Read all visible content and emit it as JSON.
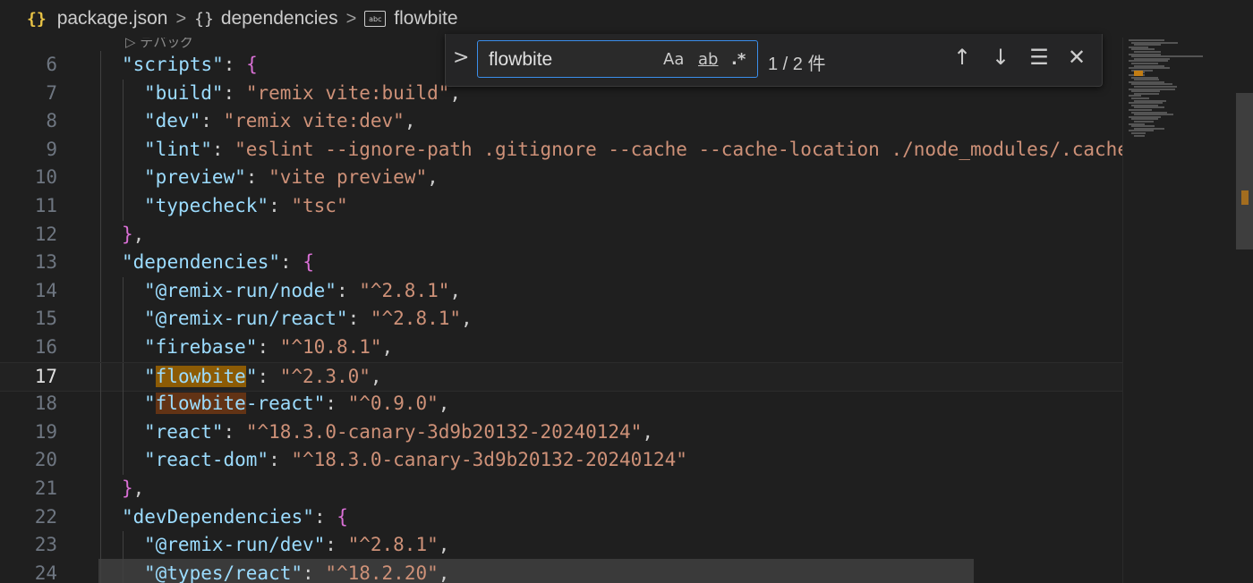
{
  "breadcrumb": {
    "file_icon": "{}",
    "file": "package.json",
    "obj_icon": "{}",
    "section": "dependencies",
    "string_icon": "abc",
    "item": "flowbite",
    "separator": ">"
  },
  "codelens": {
    "icon": "▷",
    "label": "デバッグ"
  },
  "find": {
    "toggle": ">",
    "query": "flowbite",
    "match_case": "Aa",
    "whole_word": "ab",
    "regex": ".*",
    "count": "1 / 2 件",
    "prev": "↑",
    "next": "↓",
    "find_in_selection": "☰",
    "close": "✕"
  },
  "lines": [
    {
      "n": "6",
      "indent": 1,
      "key": "\"scripts\"",
      "mid": ": ",
      "open": "{"
    },
    {
      "n": "7",
      "indent": 2,
      "key": "\"build\"",
      "mid": ": ",
      "value": "\"remix vite:build\"",
      "tail": ","
    },
    {
      "n": "8",
      "indent": 2,
      "key": "\"dev\"",
      "mid": ": ",
      "value": "\"remix vite:dev\"",
      "tail": ","
    },
    {
      "n": "9",
      "indent": 2,
      "key": "\"lint\"",
      "mid": ": ",
      "value": "\"eslint --ignore-path .gitignore --cache --cache-location ./node_modules/.cache\"",
      "tail": ""
    },
    {
      "n": "10",
      "indent": 2,
      "key": "\"preview\"",
      "mid": ": ",
      "value": "\"vite preview\"",
      "tail": ","
    },
    {
      "n": "11",
      "indent": 2,
      "key": "\"typecheck\"",
      "mid": ": ",
      "value": "\"tsc\"",
      "tail": ""
    },
    {
      "n": "12",
      "indent": 1,
      "close": "}",
      "tail": ","
    },
    {
      "n": "13",
      "indent": 1,
      "key": "\"dependencies\"",
      "mid": ": ",
      "open": "{"
    },
    {
      "n": "14",
      "indent": 2,
      "key": "\"@remix-run/node\"",
      "mid": ": ",
      "value": "\"^2.8.1\"",
      "tail": ","
    },
    {
      "n": "15",
      "indent": 2,
      "key": "\"@remix-run/react\"",
      "mid": ": ",
      "value": "\"^2.8.1\"",
      "tail": ","
    },
    {
      "n": "16",
      "indent": 2,
      "key": "\"firebase\"",
      "mid": ": ",
      "value": "\"^10.8.1\"",
      "tail": ","
    },
    {
      "n": "17",
      "indent": 2,
      "q": "\"",
      "match": "flowbite",
      "rest": "\"",
      "mid": ": ",
      "value": "\"^2.3.0\"",
      "tail": ",",
      "current": true,
      "hl": "cur"
    },
    {
      "n": "18",
      "indent": 2,
      "q": "\"",
      "match": "flowbite",
      "rest": "-react\"",
      "mid": ": ",
      "value": "\"^0.9.0\"",
      "tail": ",",
      "hl": "oth"
    },
    {
      "n": "19",
      "indent": 2,
      "key": "\"react\"",
      "mid": ": ",
      "value": "\"^18.3.0-canary-3d9b20132-20240124\"",
      "tail": ","
    },
    {
      "n": "20",
      "indent": 2,
      "key": "\"react-dom\"",
      "mid": ": ",
      "value": "\"^18.3.0-canary-3d9b20132-20240124\"",
      "tail": ""
    },
    {
      "n": "21",
      "indent": 1,
      "close": "}",
      "tail": ","
    },
    {
      "n": "22",
      "indent": 1,
      "key": "\"devDependencies\"",
      "mid": ": ",
      "open": "{"
    },
    {
      "n": "23",
      "indent": 2,
      "key": "\"@remix-run/dev\"",
      "mid": ": ",
      "value": "\"^2.8.1\"",
      "tail": ","
    },
    {
      "n": "24",
      "indent": 2,
      "key": "\"@types/react\"",
      "mid": ": ",
      "value": "\"^18.2.20\"",
      "tail": ","
    }
  ],
  "colors": {
    "key": "#9cdcfe",
    "string": "#ce9178",
    "brace": "#da70d6",
    "match_current": "#8c5b05",
    "match_other": "#623315",
    "find_border": "#3b8eea"
  }
}
